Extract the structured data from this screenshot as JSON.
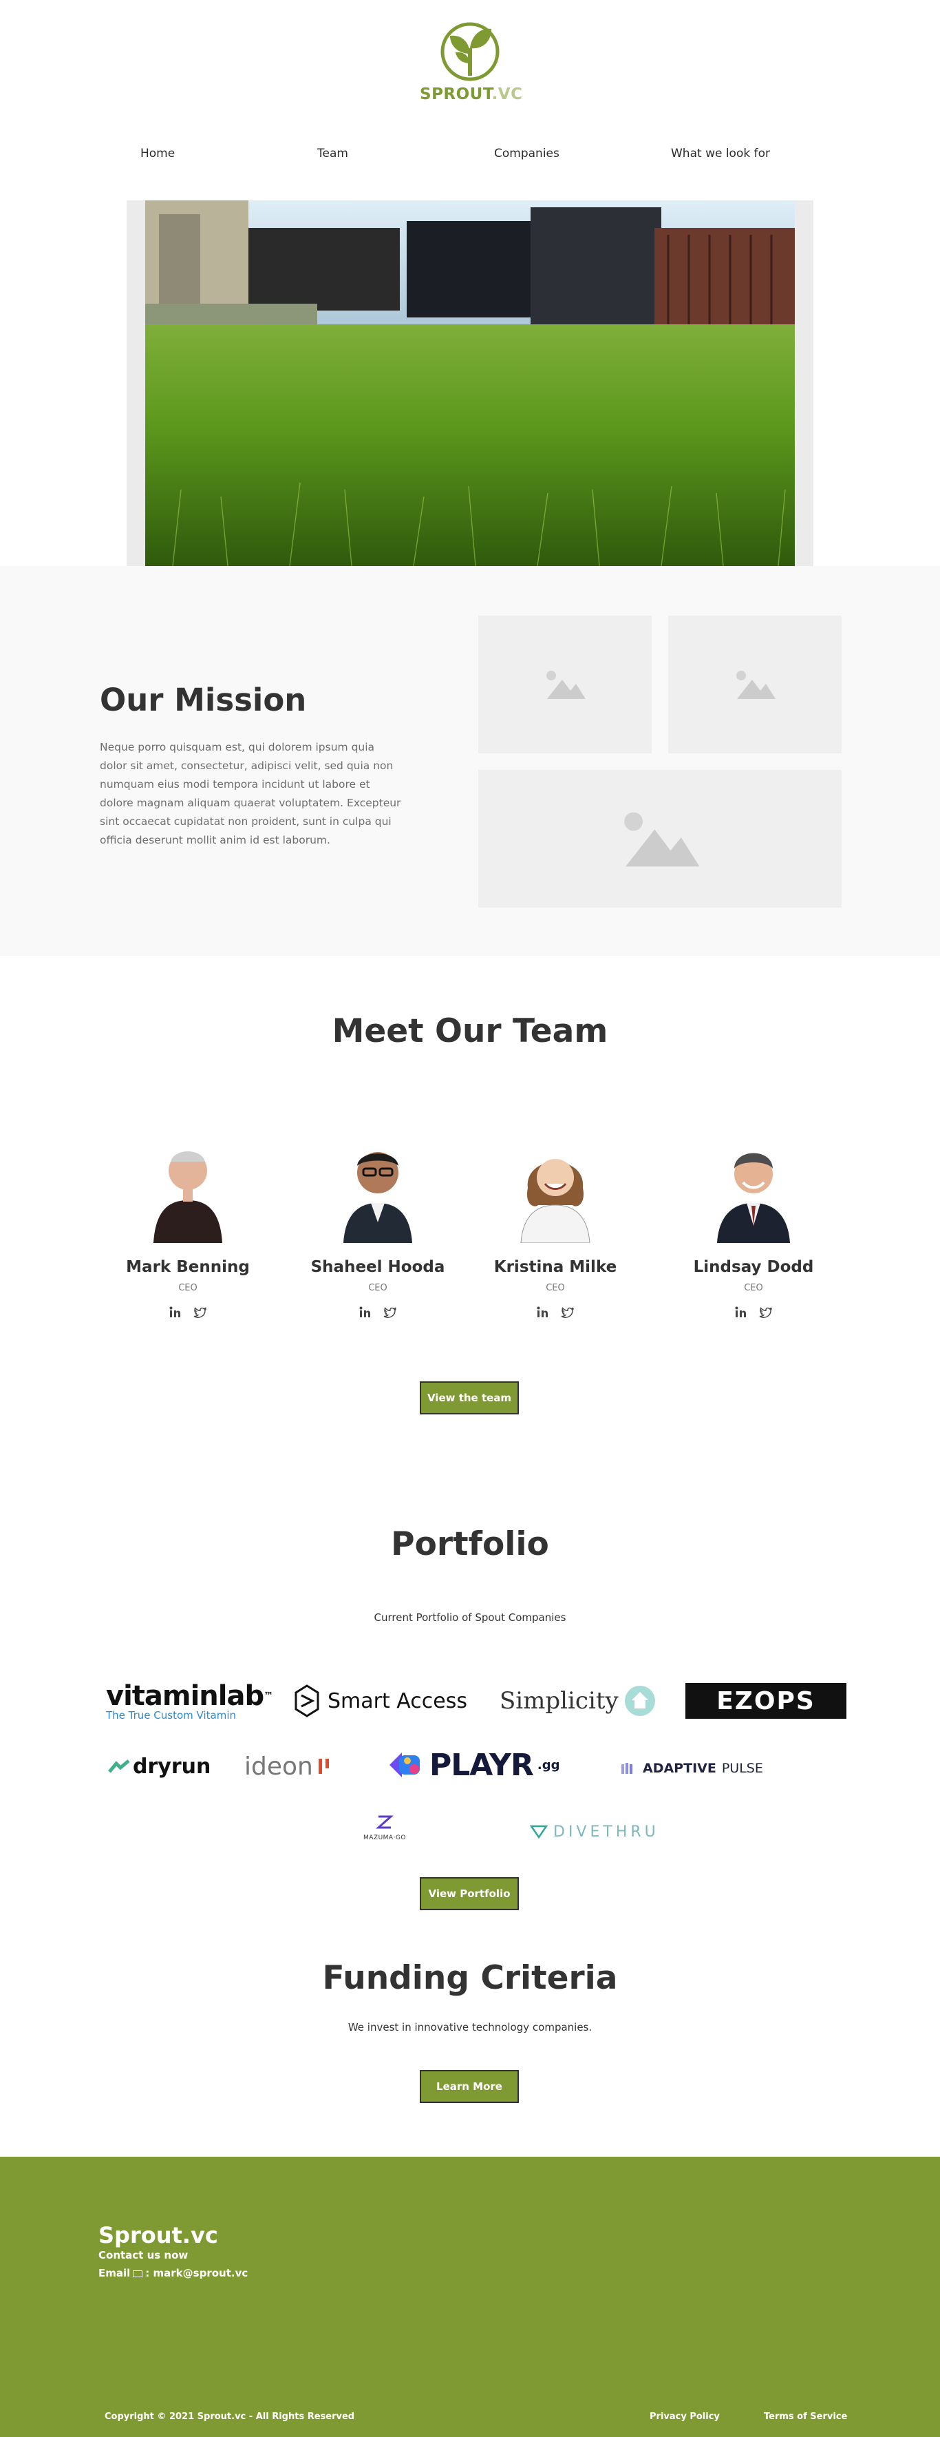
{
  "header": {
    "logo_text": "SPROUT",
    "logo_suffix": ".VC"
  },
  "nav": {
    "items": [
      {
        "label": "Home"
      },
      {
        "label": "Team"
      },
      {
        "label": "Companies"
      },
      {
        "label": "What we look for"
      }
    ]
  },
  "mission": {
    "title": "Our Mission",
    "body": "Neque porro quisquam est, qui dolorem ipsum quia dolor sit amet, consectetur, adipisci velit, sed quia non numquam eius modi tempora incidunt ut labore et dolore magnam aliquam quaerat voluptatem. Excepteur sint occaecat cupidatat non proident, sunt in culpa qui officia deserunt mollit anim id est laborum."
  },
  "team": {
    "title": "Meet Our Team",
    "members": [
      {
        "name": "Mark Benning",
        "role": "CEO"
      },
      {
        "name": "Shaheel Hooda",
        "role": "CEO"
      },
      {
        "name": "Kristina Milke",
        "role": "CEO"
      },
      {
        "name": "Lindsay Dodd",
        "role": "CEO"
      }
    ],
    "button_label": "View the team"
  },
  "portfolio": {
    "title": "Portfolio",
    "subtitle": "Current Portfolio of Spout Companies",
    "logos": {
      "vitaminlab": "vitaminlab",
      "vitaminlab_tm": "™",
      "vitaminlab_tagline": "The True Custom Vitamin",
      "smart_access": "Smart Access",
      "simplicity": "Simplicity",
      "ezops": "EZOPS",
      "dryrun": "dryrun",
      "ideon": "ideon",
      "playr": "PLAYR",
      "playr_suffix": ".gg",
      "adaptive_pulse_a": "ADAPTIVE",
      "adaptive_pulse_b": "PULSE",
      "mazumago": "MAZUMA·GO",
      "divethru": "DIVETHRU"
    },
    "button_label": "View Portfolio"
  },
  "funding": {
    "title": "Funding Criteria",
    "subtitle": "We invest in innovative technology companies.",
    "button_label": "Learn More"
  },
  "footer": {
    "brand": "Sprout.vc",
    "contact_line": "Contact us now",
    "email_label": "Email",
    "email": "mark@sprout.vc",
    "copyright": "Copyright © 2021 Sprout.vc - All Rights Reserved",
    "privacy": "Privacy Policy",
    "terms": "Terms of Service"
  },
  "colors": {
    "brand_green": "#7f9a32",
    "dark_text": "#333333",
    "mission_bg": "#f9f9f9",
    "placeholder_bg": "#efefef"
  }
}
